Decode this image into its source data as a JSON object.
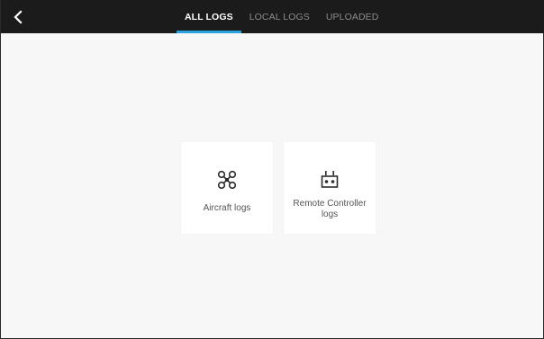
{
  "header": {
    "back_icon": "chevron-left-icon",
    "tabs": [
      {
        "label": "ALL LOGS",
        "active": true
      },
      {
        "label": "LOCAL LOGS",
        "active": false
      },
      {
        "label": "UPLOADED",
        "active": false
      }
    ]
  },
  "main": {
    "cards": [
      {
        "label": "Aircraft logs",
        "icon": "drone-icon"
      },
      {
        "label": "Remote Controller logs",
        "icon": "remote-controller-icon"
      }
    ]
  },
  "colors": {
    "header_bg": "#1b1b1b",
    "accent": "#2ba3de",
    "page_bg": "#f7f7f7"
  }
}
